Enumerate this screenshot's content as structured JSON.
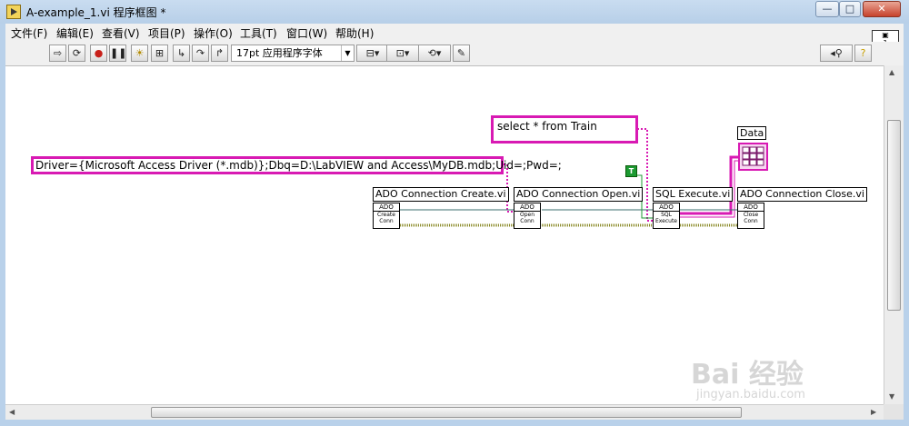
{
  "window": {
    "title": "A-example_1.vi 程序框图 *",
    "minimize": "—",
    "maximize": "□",
    "close": "✕"
  },
  "menu": [
    "文件(F)",
    "编辑(E)",
    "查看(V)",
    "项目(P)",
    "操作(O)",
    "工具(T)",
    "窗口(W)",
    "帮助(H)"
  ],
  "toolbar": {
    "font": "17pt 应用程序字体",
    "run_icon": "run-arrow-icon",
    "search_icon": "search-icon",
    "help_icon": "help-icon"
  },
  "diagram": {
    "select_string": "select * from Train",
    "connection_string": "Driver={Microsoft Access Driver (*.mdb)};Dbq=D:\\LabVIEW and Access\\MyDB.mdb;Uid=;Pwd=;",
    "bool_const": "T",
    "data_label": "Data",
    "vis": [
      {
        "label": "ADO Connection Create.vi",
        "hdr": "ADO",
        "line1": "Create",
        "line2": "Conn"
      },
      {
        "label": "ADO Connection Open.vi",
        "hdr": "ADO",
        "line1": "Open",
        "line2": "Conn"
      },
      {
        "label": "SQL Execute.vi",
        "hdr": "ADO",
        "line1": "SQL",
        "line2": "Execute"
      },
      {
        "label": "ADO Connection Close.vi",
        "hdr": "ADO",
        "line1": "Close",
        "line2": "Conn"
      }
    ]
  },
  "watermark": {
    "main": "Bai 经验",
    "sub": "jingyan.baidu.com"
  }
}
